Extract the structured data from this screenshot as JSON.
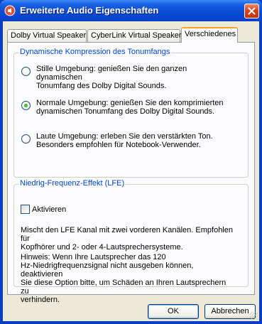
{
  "window": {
    "title": "Erweiterte Audio Eigenschaften",
    "icon": "audio-app-icon",
    "close_icon": "close-icon"
  },
  "tabs": [
    {
      "label": "Dolby Virtual Speaker",
      "active": false
    },
    {
      "label": "CyberLink Virtual Speaker",
      "active": false
    },
    {
      "label": "Verschiedenes",
      "active": true
    }
  ],
  "compression": {
    "legend": "Dynamische Kompression des Tonumfangs",
    "options": [
      {
        "line1": "Stille Umgebung: genießen Sie den ganzen dynamischen",
        "line2": "Tonumfang des Dolby Digital Sounds.",
        "selected": false
      },
      {
        "line1": "Normale Umgebung: genießen Sie den komprimierten",
        "line2": "dynamischen Tonumfang des Dolby Digital Sounds.",
        "selected": true
      },
      {
        "line1": "Laute Umgebung: erleben Sie den verstärkten Ton.",
        "line2": "Besonders empfohlen für Notebook-Verwender.",
        "selected": false
      }
    ]
  },
  "lfe": {
    "legend": "Niedrig-Frequenz-Effekt (LFE)",
    "checkbox_label": "Aktivieren",
    "checked": false,
    "description": [
      "Mischt den LFE Kanal mit zwei vorderen Kanälen. Empfohlen für",
      "Kopfhörer und 2- oder 4-Lautsprechersysteme."
    ],
    "note": [
      "Hinweis: Wenn Ihre Lautsprecher das 120",
      "Hz-Niedrigfrequenzsignal nicht ausgeben können, deaktivieren",
      "Sie diese Option bitte, um Schäden an Ihren Lautsprechern zu",
      "verhindern."
    ]
  },
  "buttons": {
    "ok": "OK",
    "cancel": "Abbrechen"
  },
  "colors": {
    "title_bar": "#0a4fd8",
    "legend_text": "#0046d5",
    "active_tab_accent": "#f5a623",
    "close_button": "#d8431c"
  }
}
